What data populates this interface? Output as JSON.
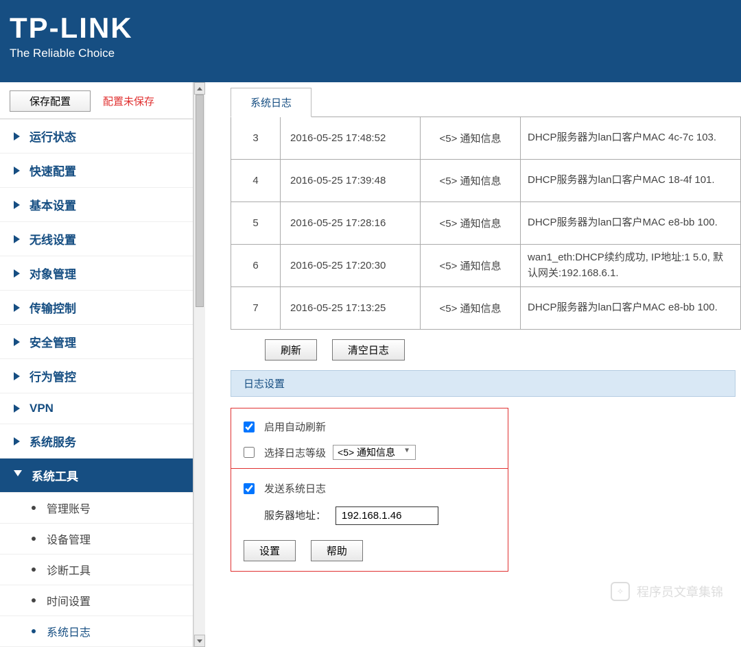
{
  "header": {
    "logo_main": "TP-LINK",
    "logo_sub": "The Reliable Choice"
  },
  "topbar": {
    "save_label": "保存配置",
    "status": "配置未保存"
  },
  "nav": {
    "items": [
      {
        "label": "运行状态"
      },
      {
        "label": "快速配置"
      },
      {
        "label": "基本设置"
      },
      {
        "label": "无线设置"
      },
      {
        "label": "对象管理"
      },
      {
        "label": "传输控制"
      },
      {
        "label": "安全管理"
      },
      {
        "label": "行为管控"
      },
      {
        "label": "VPN"
      },
      {
        "label": "系统服务"
      },
      {
        "label": "系统工具"
      }
    ],
    "sub_items": [
      {
        "label": "管理账号"
      },
      {
        "label": "设备管理"
      },
      {
        "label": "诊断工具"
      },
      {
        "label": "时间设置"
      },
      {
        "label": "系统日志"
      }
    ]
  },
  "tab": {
    "label": "系统日志"
  },
  "logs": [
    {
      "idx": "3",
      "ts": "2016-05-25 17:48:52",
      "lvl": "<5> 通知信息",
      "msg": "DHCP服务器为lan口客户MAC 4c-7c 103."
    },
    {
      "idx": "4",
      "ts": "2016-05-25 17:39:48",
      "lvl": "<5> 通知信息",
      "msg": "DHCP服务器为lan口客户MAC 18-4f 101."
    },
    {
      "idx": "5",
      "ts": "2016-05-25 17:28:16",
      "lvl": "<5> 通知信息",
      "msg": "DHCP服务器为lan口客户MAC e8-bb 100."
    },
    {
      "idx": "6",
      "ts": "2016-05-25 17:20:30",
      "lvl": "<5> 通知信息",
      "msg": "wan1_eth:DHCP续约成功, IP地址:1 5.0, 默认网关:192.168.6.1."
    },
    {
      "idx": "7",
      "ts": "2016-05-25 17:13:25",
      "lvl": "<5> 通知信息",
      "msg": "DHCP服务器为lan口客户MAC e8-bb 100."
    }
  ],
  "buttons": {
    "refresh": "刷新",
    "clear": "清空日志",
    "set": "设置",
    "help": "帮助"
  },
  "settings": {
    "section_title": "日志设置",
    "auto_refresh_label": "启用自动刷新",
    "auto_refresh_checked": true,
    "select_level_label": "选择日志等级",
    "select_level_checked": false,
    "level_value": "<5> 通知信息",
    "send_syslog_label": "发送系统日志",
    "send_syslog_checked": true,
    "server_addr_label": "服务器地址：",
    "server_addr_value": "192.168.1.46"
  },
  "watermark": "程序员文章集锦"
}
